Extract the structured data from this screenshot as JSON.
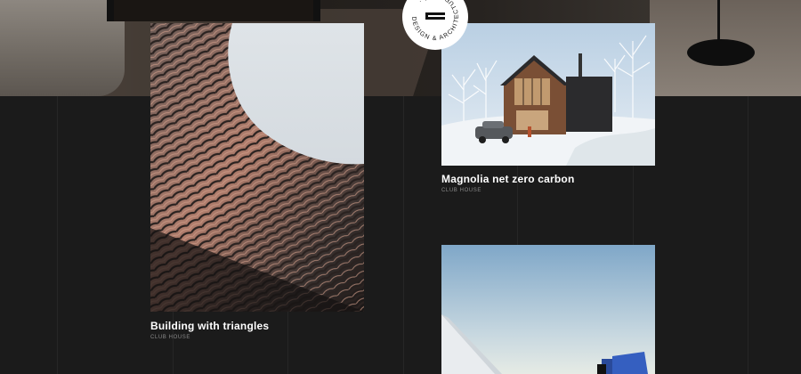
{
  "badge": {
    "text": "DESIGN & ARCHITECTURE · UK ·"
  },
  "projects": [
    {
      "title": "Building with triangles",
      "category": "CLUB HOUSE"
    },
    {
      "title": "Magnolia net zero carbon",
      "category": "CLUB HOUSE"
    },
    {
      "title": "",
      "category": ""
    }
  ]
}
